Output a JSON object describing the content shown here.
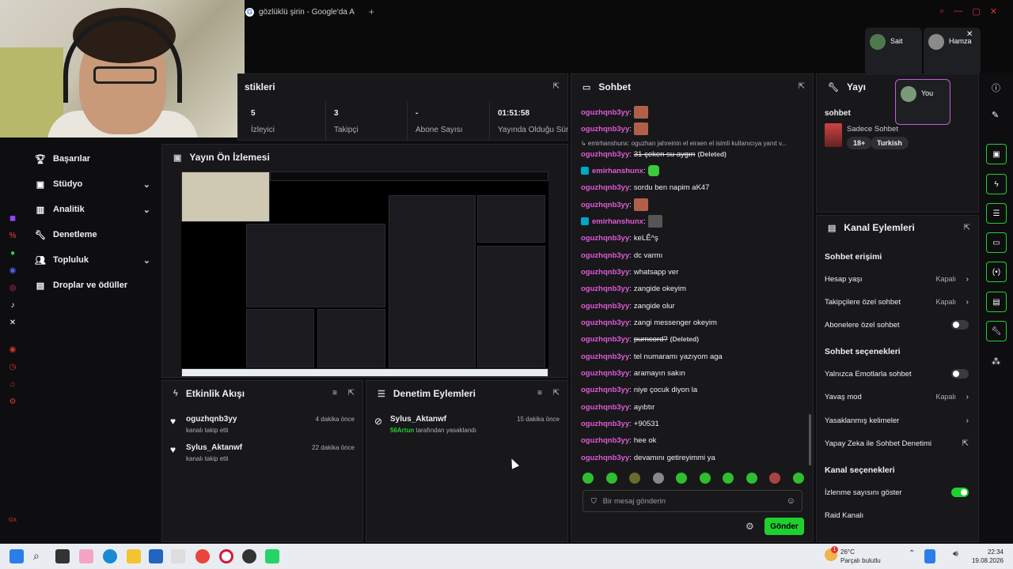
{
  "browser": {
    "tab_title": "gözlüklü şirin - Google'da A",
    "new_tab": "+"
  },
  "sidebar": {
    "items": [
      {
        "label": "Başarılar",
        "icon": "trophy-icon",
        "expandable": false
      },
      {
        "label": "Stüdyo",
        "icon": "camera-icon",
        "expandable": true
      },
      {
        "label": "Analitik",
        "icon": "chart-icon",
        "expandable": true
      },
      {
        "label": "Denetleme",
        "icon": "wrench-icon",
        "expandable": false
      },
      {
        "label": "Topluluk",
        "icon": "people-icon",
        "expandable": true
      },
      {
        "label": "Droplar ve ödüller",
        "icon": "gift-icon",
        "expandable": false
      }
    ]
  },
  "stats": {
    "title": "stikleri",
    "cells": [
      {
        "value": "5",
        "label": "İzleyici"
      },
      {
        "value": "3",
        "label": "Takipçi"
      },
      {
        "value": "-",
        "label": "Abone Sayısı"
      },
      {
        "value": "01:51:58",
        "label": "Yayında Olduğu Süre"
      }
    ]
  },
  "preview": {
    "title": "Yayın Ön İzlemesi"
  },
  "activity": {
    "title": "Etkinlik Akışı",
    "events": [
      {
        "name": "oguzhqnb3yy",
        "sub": "kanalı takip etti",
        "time": "4 dakika önce"
      },
      {
        "name": "Sylus_Aktanwf",
        "sub": "kanalı takip etti",
        "time": "22 dakika önce"
      }
    ]
  },
  "moderation": {
    "title": "Denetim Eylemleri",
    "events": [
      {
        "name": "Sylus_Aktanwf",
        "actor": "56Artun",
        "sub": "tarafından yasaklandı",
        "time": "15 dakika önce"
      }
    ]
  },
  "chat": {
    "title": "Sohbet",
    "reply_note": "↳ emirhanshunx: oguzhan jahreinin el eiraen el isimli kullanıcıya yanıt v...",
    "lines": [
      {
        "user": "oguzhqnb3yy",
        "text": "",
        "emote": true
      },
      {
        "user": "oguzhqnb3yy",
        "text": "",
        "emote": true
      },
      {
        "user": "oguzhqnb3yy",
        "text": "31 çeken su aygırı",
        "deleted": "(Deleted)"
      },
      {
        "user": "emirhanshunx",
        "text": "",
        "emote_green": true,
        "badge": true
      },
      {
        "user": "oguzhqnb3yy",
        "text": "sordu ben napim aK47"
      },
      {
        "user": "oguzhqnb3yy",
        "text": "",
        "emote": true
      },
      {
        "user": "emirhanshunx",
        "text": "",
        "emote": true,
        "badge": true
      },
      {
        "user": "oguzhqnb3yy",
        "text": "keLÊ^ş"
      },
      {
        "user": "oguzhqnb3yy",
        "text": "dc varmı"
      },
      {
        "user": "oguzhqnb3yy",
        "text": "whatsapp ver"
      },
      {
        "user": "oguzhqnb3yy",
        "text": "zangide okeyim"
      },
      {
        "user": "oguzhqnb3yy",
        "text": "zangide olur"
      },
      {
        "user": "oguzhqnb3yy",
        "text": "zangi messenger okeyim"
      },
      {
        "user": "oguzhqnb3yy",
        "text": "purncord?",
        "deleted": "(Deleted)"
      },
      {
        "user": "oguzhqnb3yy",
        "text": "tel numaramı yazıyom aga"
      },
      {
        "user": "oguzhqnb3yy",
        "text": "aramayın sakın"
      },
      {
        "user": "oguzhqnb3yy",
        "text": "niye çocuk diyon la"
      },
      {
        "user": "oguzhqnb3yy",
        "text": "ayıbtır"
      },
      {
        "user": "oguzhqnb3yy",
        "text": "+90531"
      },
      {
        "user": "oguzhqnb3yy",
        "text": "hee ok"
      },
      {
        "user": "oguzhqnb3yy",
        "text": "devamını getireyimmi ya"
      }
    ],
    "input_placeholder": "Bir mesaj gönderin",
    "send_label": "Gönder"
  },
  "stream_info": {
    "title": "Yayı",
    "section": "sohbet",
    "stream_title": "Sadece Sohbet",
    "tags": [
      "18+",
      "Turkish"
    ]
  },
  "channel_actions": {
    "title": "Kanal Eylemleri",
    "sections": [
      {
        "heading": "Sohbet erişimi",
        "rows": [
          {
            "label": "Hesap yaşı",
            "value": "Kapalı",
            "type": "arrow"
          },
          {
            "label": "Takipçilere özel sohbet",
            "value": "Kapalı",
            "type": "arrow"
          },
          {
            "label": "Abonelere özel sohbet",
            "value": "",
            "type": "toggle",
            "on": false
          }
        ]
      },
      {
        "heading": "Sohbet seçenekleri",
        "rows": [
          {
            "label": "Yalnızca Emotlarla sohbet",
            "value": "",
            "type": "toggle",
            "on": false
          },
          {
            "label": "Yavaş mod",
            "value": "Kapalı",
            "type": "arrow"
          },
          {
            "label": "Yasaklanmış kelimeler",
            "value": "",
            "type": "arrow"
          },
          {
            "label": "Yapay Zeka ile Sohbet Denetimi",
            "value": "",
            "type": "external"
          }
        ]
      },
      {
        "heading": "Kanal seçenekleri",
        "rows": [
          {
            "label": "İzlenme sayısını göster",
            "value": "",
            "type": "toggle",
            "on": true
          },
          {
            "label": "Raid Kanalı",
            "value": "",
            "type": "none"
          }
        ]
      }
    ]
  },
  "call": {
    "participants": [
      "Sait",
      "Hamza",
      "You"
    ]
  },
  "taskbar": {
    "weather_temp": "26°C",
    "weather_desc": "Parçalı bulutlu",
    "notification_count": "1",
    "time": "22:34",
    "date": "19.08.2026"
  }
}
